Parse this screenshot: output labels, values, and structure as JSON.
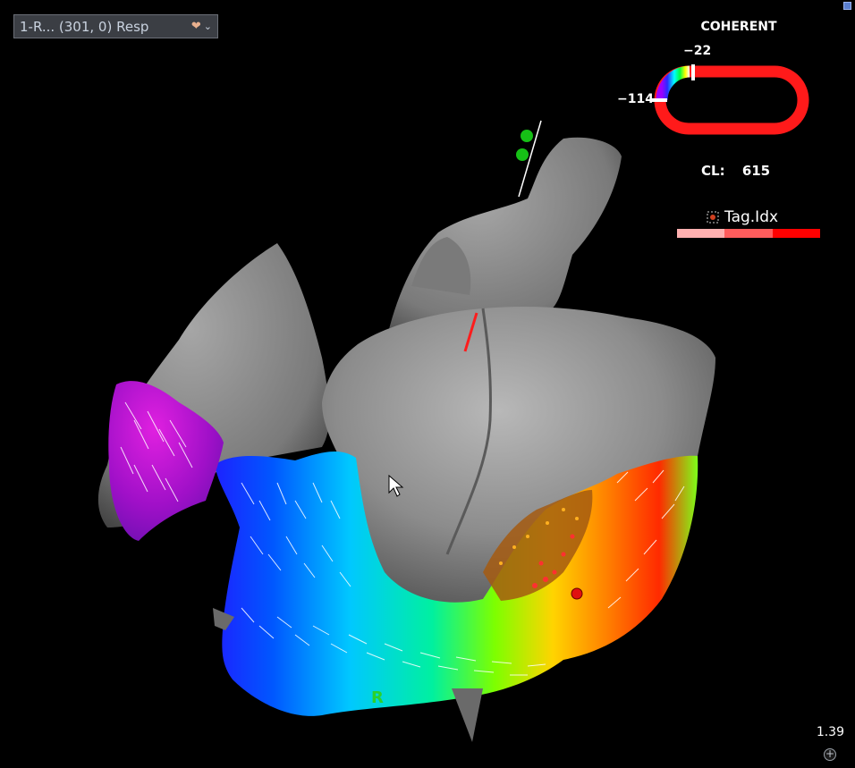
{
  "map_selector": {
    "label": "1-R... (301, 0) Resp",
    "icon": "heart-catheter-icon",
    "chevron": "⌄"
  },
  "legend": {
    "title": "COHERENT",
    "top_value": "−22",
    "left_value": "−114",
    "colors": {
      "ring": "#ff1a1a",
      "gradient": [
        "#8b00ff",
        "#2040ff",
        "#00ffff",
        "#00ff40",
        "#ffff00",
        "#ff8000"
      ]
    }
  },
  "cycle_length": {
    "label": "CL:",
    "value": "615"
  },
  "tag_index": {
    "label": "Tag.Idx",
    "icon": "tag-grid-icon",
    "colors": [
      "#ffb0b0",
      "#ff5c5c",
      "#ff0000"
    ]
  },
  "zoom": {
    "value": "1.39",
    "button_glyph": "+"
  },
  "anatomy_marker": {
    "label": "R",
    "color": "#2bd12b"
  }
}
